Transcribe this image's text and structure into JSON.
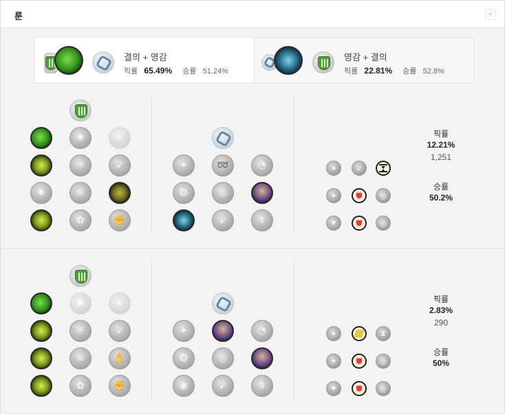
{
  "header": {
    "title": "룬",
    "expand_label": "+"
  },
  "summary": [
    {
      "title": "결의 + 영감",
      "pick_label": "픽률",
      "pick_value": "65.49%",
      "win_label": "승률",
      "win_value": "51.24%"
    },
    {
      "title": "영감 + 결의",
      "pick_label": "픽률",
      "pick_value": "22.81%",
      "win_label": "승률",
      "win_value": "52.8%"
    }
  ],
  "builds": [
    {
      "pick_label": "픽률",
      "pick_value": "12.21%",
      "games": "1,251",
      "win_label": "승률",
      "win_value": "50.2%"
    },
    {
      "pick_label": "픽률",
      "pick_value": "2.83%",
      "games": "290",
      "win_label": "승률",
      "win_value": "50%"
    }
  ],
  "colors": {
    "resolve": "#4fa23a",
    "inspiration": "#5d87a8",
    "shard_active_ring": "#1d1d1d",
    "shard_red": "#e03c3c"
  },
  "icons": {
    "resolve_tree": "resolve-tree-icon",
    "inspiration_tree": "inspiration-tree-icon",
    "grasp": "grasp-of-the-undying-icon",
    "aftershock": "aftershock-icon",
    "guardian": "guardian-icon",
    "glacial": "glacial-augment-icon",
    "unsealed": "unsealed-spellbook-icon"
  }
}
